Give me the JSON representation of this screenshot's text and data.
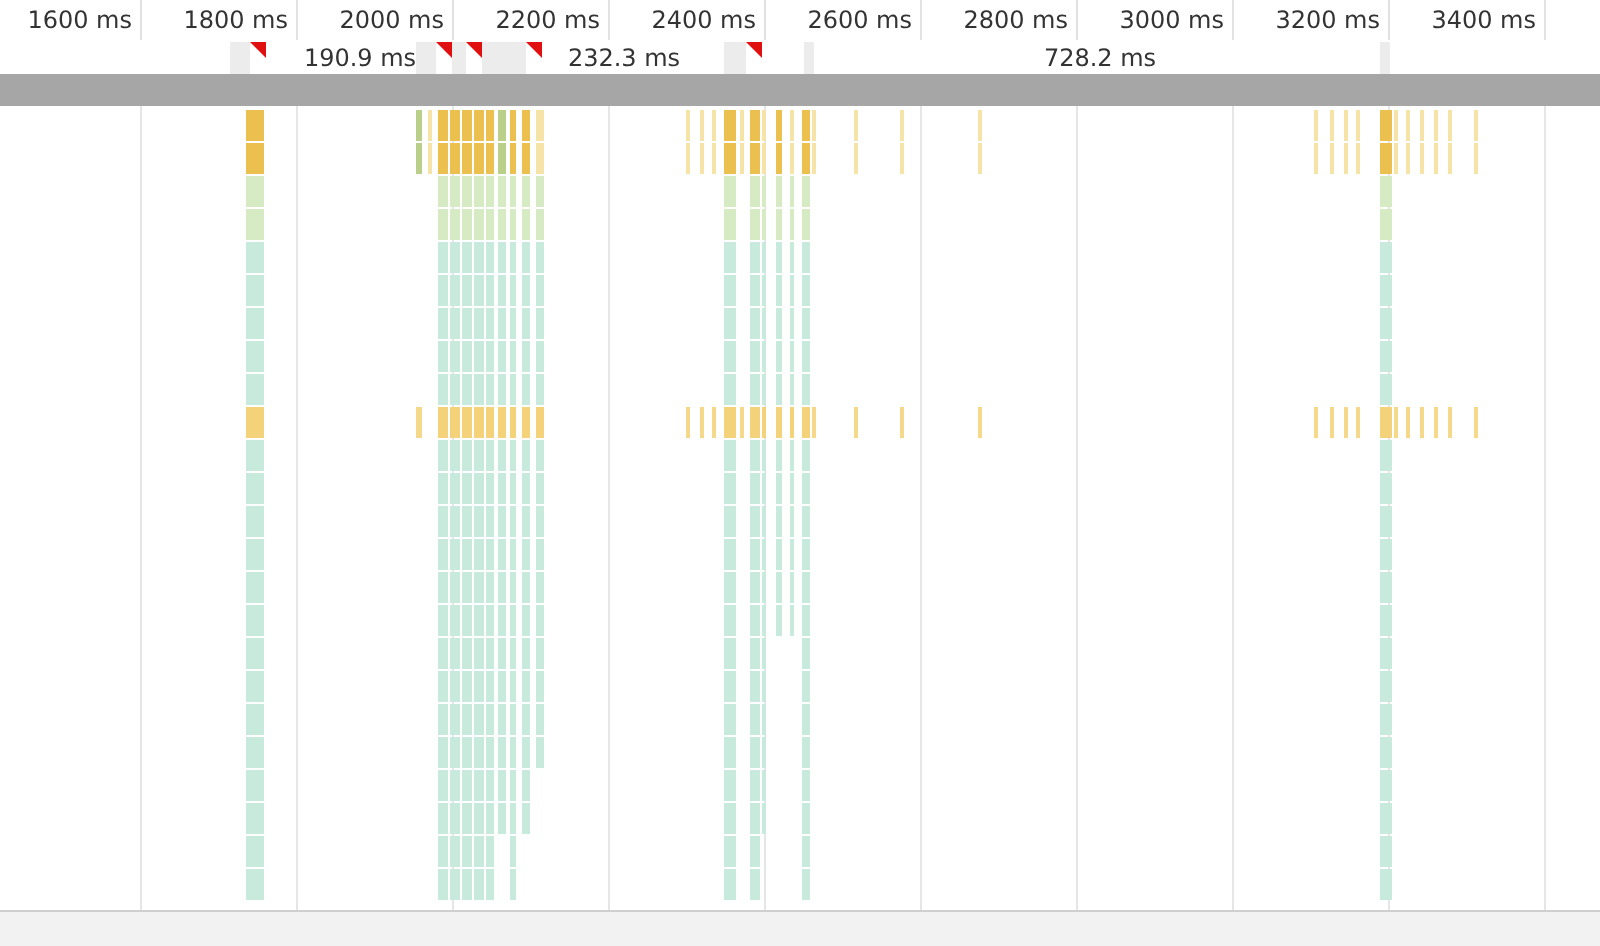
{
  "timeline": {
    "ticks": [
      "1600 ms",
      "1800 ms",
      "2000 ms",
      "2200 ms",
      "2400 ms",
      "2600 ms",
      "2800 ms",
      "3000 ms",
      "3200 ms",
      "3400 ms"
    ],
    "frames": [
      {
        "duration": "190.9 ms"
      },
      {
        "duration": "232.3 ms"
      },
      {
        "duration": "728.2 ms"
      }
    ]
  }
}
